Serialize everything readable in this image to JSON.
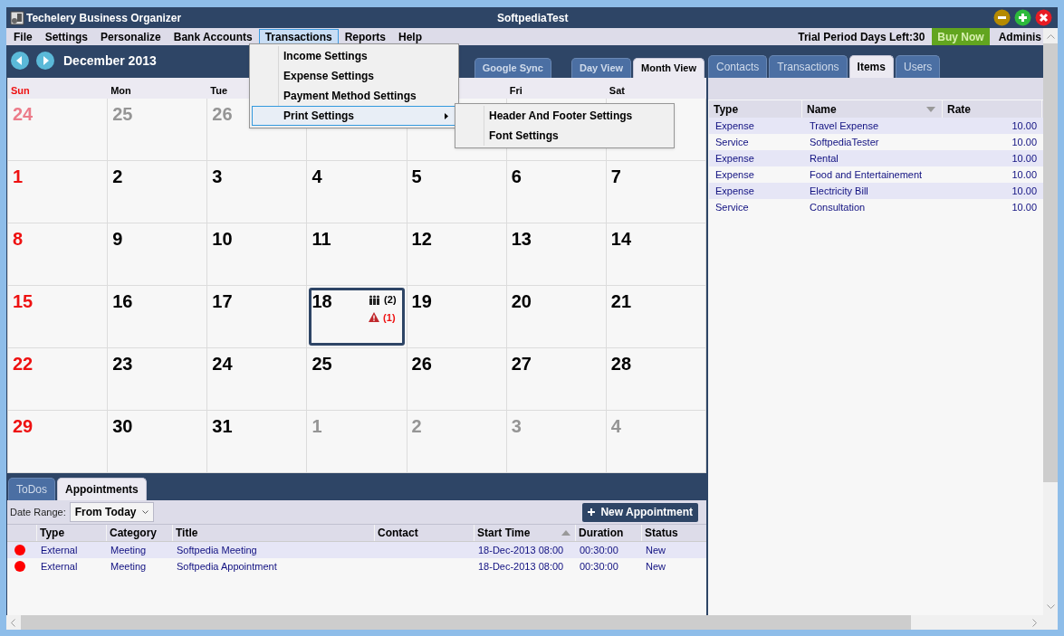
{
  "window": {
    "title": "Techelery Business Organizer",
    "user": "SoftpediaTest"
  },
  "menu": [
    {
      "label": "File",
      "selected": false
    },
    {
      "label": "Settings",
      "selected": false
    },
    {
      "label": "Personalize",
      "selected": false
    },
    {
      "label": "Bank Accounts",
      "selected": false
    },
    {
      "label": "Transactions",
      "selected": true
    },
    {
      "label": "Reports",
      "selected": false
    },
    {
      "label": "Help",
      "selected": false
    }
  ],
  "trial": "Trial Period Days Left:30",
  "buy_button": "Buy Now",
  "account": "Adminis",
  "transactions_menu": [
    {
      "label": "Income Settings",
      "selected": false,
      "has_submenu": false
    },
    {
      "label": "Expense Settings",
      "selected": false,
      "has_submenu": false
    },
    {
      "label": "Payment Method Settings",
      "selected": false,
      "has_submenu": false
    },
    {
      "label": "Print Settings",
      "selected": true,
      "has_submenu": true
    }
  ],
  "print_submenu": [
    "Header And Footer Settings",
    "Font Settings"
  ],
  "calendar": {
    "title": "December 2013",
    "tabs": [
      {
        "label": "Google Sync",
        "selected": false
      },
      {
        "label": "Day View",
        "selected": false
      },
      {
        "label": "Month View",
        "selected": true
      }
    ],
    "weekdays": [
      {
        "label": "Sun",
        "weekend": true
      },
      {
        "label": "Mon",
        "weekend": false
      },
      {
        "label": "Tue",
        "weekend": false
      },
      {
        "label": "Fri",
        "weekend": false
      },
      {
        "label": "Sat",
        "weekend": false
      }
    ],
    "weeks": [
      [
        {
          "number": "24",
          "in_month": false,
          "sunday": true,
          "selected": false
        },
        {
          "number": "25",
          "in_month": false,
          "sunday": false,
          "selected": false
        },
        {
          "number": "26",
          "in_month": false,
          "sunday": false,
          "selected": false
        },
        {
          "selected": false
        },
        {
          "selected": false
        },
        {
          "selected": false
        },
        {
          "selected": false
        }
      ],
      [
        {
          "number": "1",
          "in_month": true,
          "sunday": true,
          "selected": false
        },
        {
          "number": "2",
          "in_month": true,
          "sunday": false,
          "selected": false
        },
        {
          "number": "3",
          "in_month": true,
          "sunday": false,
          "selected": false
        },
        {
          "number": "4",
          "in_month": true,
          "sunday": false,
          "selected": false
        },
        {
          "number": "5",
          "in_month": true,
          "sunday": false,
          "selected": false
        },
        {
          "number": "6",
          "in_month": true,
          "sunday": false,
          "selected": false
        },
        {
          "number": "7",
          "in_month": true,
          "sunday": false,
          "selected": false
        }
      ],
      [
        {
          "number": "8",
          "in_month": true,
          "sunday": true,
          "selected": false
        },
        {
          "number": "9",
          "in_month": true,
          "sunday": false,
          "selected": false
        },
        {
          "number": "10",
          "in_month": true,
          "sunday": false,
          "selected": false
        },
        {
          "number": "11",
          "in_month": true,
          "sunday": false,
          "selected": false
        },
        {
          "number": "12",
          "in_month": true,
          "sunday": false,
          "selected": false
        },
        {
          "number": "13",
          "in_month": true,
          "sunday": false,
          "selected": false
        },
        {
          "number": "14",
          "in_month": true,
          "sunday": false,
          "selected": false
        }
      ],
      [
        {
          "number": "15",
          "in_month": true,
          "sunday": true,
          "selected": false
        },
        {
          "number": "16",
          "in_month": true,
          "sunday": false,
          "selected": false
        },
        {
          "number": "17",
          "in_month": true,
          "sunday": false,
          "selected": false
        },
        {
          "number": "18",
          "in_month": true,
          "sunday": false,
          "selected": true,
          "events": [
            {
              "kind": "people",
              "count": "(2)"
            },
            {
              "kind": "warning",
              "count": "(1)"
            }
          ]
        },
        {
          "number": "19",
          "in_month": true,
          "sunday": false,
          "selected": false
        },
        {
          "number": "20",
          "in_month": true,
          "sunday": false,
          "selected": false
        },
        {
          "number": "21",
          "in_month": true,
          "sunday": false,
          "selected": false
        }
      ],
      [
        {
          "number": "22",
          "in_month": true,
          "sunday": true,
          "selected": false
        },
        {
          "number": "23",
          "in_month": true,
          "sunday": false,
          "selected": false
        },
        {
          "number": "24",
          "in_month": true,
          "sunday": false,
          "selected": false
        },
        {
          "number": "25",
          "in_month": true,
          "sunday": false,
          "selected": false
        },
        {
          "number": "26",
          "in_month": true,
          "sunday": false,
          "selected": false
        },
        {
          "number": "27",
          "in_month": true,
          "sunday": false,
          "selected": false
        },
        {
          "number": "28",
          "in_month": true,
          "sunday": false,
          "selected": false
        }
      ],
      [
        {
          "number": "29",
          "in_month": true,
          "sunday": true,
          "selected": false
        },
        {
          "number": "30",
          "in_month": true,
          "sunday": false,
          "selected": false
        },
        {
          "number": "31",
          "in_month": true,
          "sunday": false,
          "selected": false
        },
        {
          "number": "1",
          "in_month": false,
          "sunday": false,
          "selected": false
        },
        {
          "number": "2",
          "in_month": false,
          "sunday": false,
          "selected": false
        },
        {
          "number": "3",
          "in_month": false,
          "sunday": false,
          "selected": false
        },
        {
          "number": "4",
          "in_month": false,
          "sunday": false,
          "selected": false
        }
      ]
    ]
  },
  "bottom": {
    "tabs": [
      {
        "label": "ToDos",
        "selected": false
      },
      {
        "label": "Appointments",
        "selected": true
      }
    ],
    "date_range_label": "Date Range:",
    "date_range": "From Today",
    "new_button": "New Appointment",
    "columns": [
      "Type",
      "Category",
      "Title",
      "Contact",
      "Start Time",
      "Duration",
      "Status"
    ],
    "rows": [
      {
        "color": "#ff0000",
        "cells": [
          "External",
          "Meeting",
          "Softpedia Meeting",
          "",
          "18-Dec-2013 08:00",
          "00:30:00",
          "New"
        ]
      },
      {
        "color": "#ff0000",
        "cells": [
          "External",
          "Meeting",
          "Softpedia Appointment",
          "",
          "18-Dec-2013 08:00",
          "00:30:00",
          "New"
        ]
      }
    ]
  },
  "side": {
    "tabs": [
      {
        "label": "Contacts",
        "selected": false
      },
      {
        "label": "Transactions",
        "selected": false
      },
      {
        "label": "Items",
        "selected": true
      },
      {
        "label": "Users",
        "selected": false
      }
    ],
    "columns": [
      "Type",
      "Name",
      "Rate"
    ],
    "rows": [
      [
        "Expense",
        "Travel Expense",
        "10.00"
      ],
      [
        "Service",
        "SoftpediaTester",
        "10.00"
      ],
      [
        "Expense",
        "Rental",
        "10.00"
      ],
      [
        "Expense",
        "Food and Entertainement",
        "10.00"
      ],
      [
        "Expense",
        "Electricity Bill",
        "10.00"
      ],
      [
        "Service",
        "Consultation",
        "10.00"
      ]
    ]
  }
}
